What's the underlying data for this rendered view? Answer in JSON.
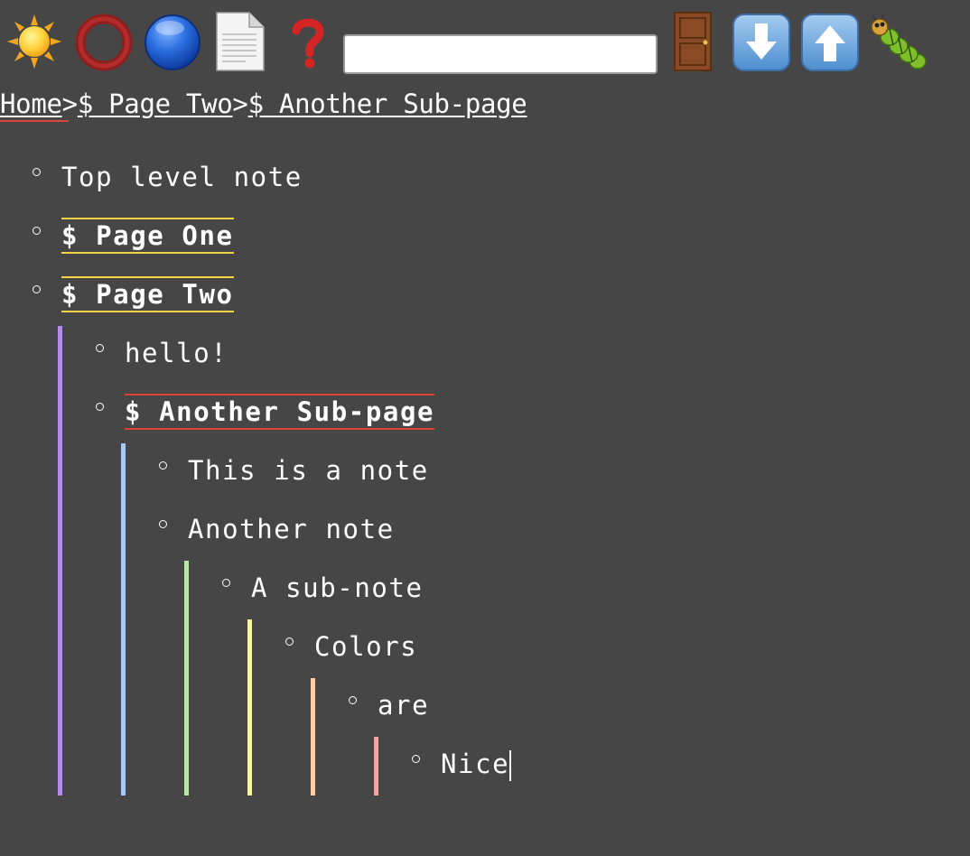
{
  "toolbar": {
    "search": {
      "value": "",
      "placeholder": ""
    },
    "buttons": [
      {
        "name": "sun-icon"
      },
      {
        "name": "red-ring-icon"
      },
      {
        "name": "blue-circle-icon"
      },
      {
        "name": "document-icon"
      },
      {
        "name": "question-mark-icon"
      },
      {
        "name": "door-icon"
      },
      {
        "name": "down-arrow-icon"
      },
      {
        "name": "up-arrow-icon"
      },
      {
        "name": "bug-icon"
      }
    ]
  },
  "breadcrumb": {
    "items": [
      "Home",
      "$ Page Two",
      "$ Another Sub-page"
    ],
    "separator": ">"
  },
  "notes": [
    {
      "text": "Top level note",
      "depth": 0,
      "type": "text"
    },
    {
      "text": "$ Page One",
      "depth": 0,
      "type": "page",
      "accent": "#f4d24a"
    },
    {
      "text": "$ Page Two",
      "depth": 0,
      "type": "page",
      "accent": "#f4d24a"
    },
    {
      "text": "hello!",
      "depth": 1,
      "type": "text"
    },
    {
      "text": "$ Another Sub-page",
      "depth": 1,
      "type": "page",
      "accent": "#d9433b"
    },
    {
      "text": "This is a note",
      "depth": 2,
      "type": "text"
    },
    {
      "text": "Another note",
      "depth": 2,
      "type": "text"
    },
    {
      "text": "A sub-note",
      "depth": 3,
      "type": "text"
    },
    {
      "text": "Colors",
      "depth": 4,
      "type": "text"
    },
    {
      "text": "are",
      "depth": 5,
      "type": "text"
    },
    {
      "text": "Nice",
      "depth": 6,
      "type": "text",
      "editing": true
    }
  ],
  "guide_colors": [
    "#b48ee8",
    "#a9c8f2",
    "#b7e8a8",
    "#fbf5a6",
    "#f7cfa8",
    "#f0a4a4"
  ]
}
